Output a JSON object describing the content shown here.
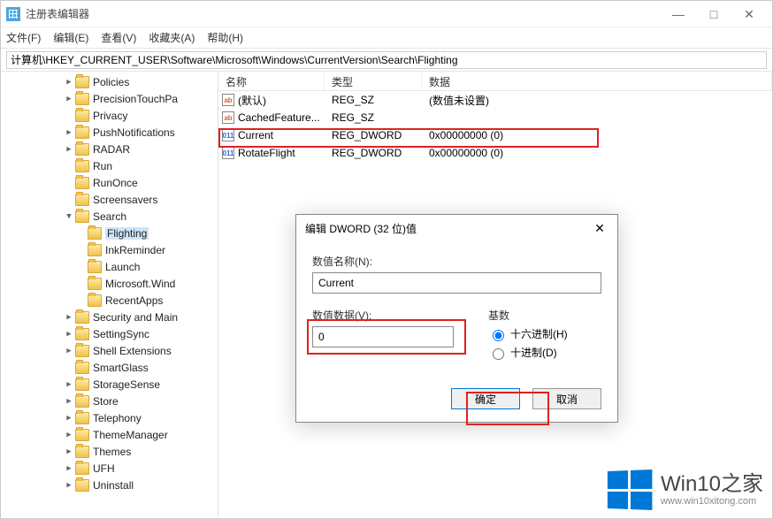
{
  "window": {
    "title": "注册表编辑器",
    "minimize": "—",
    "maximize": "□",
    "close": "✕"
  },
  "menu": {
    "file": "文件(F)",
    "edit": "编辑(E)",
    "view": "查看(V)",
    "favorites": "收藏夹(A)",
    "help": "帮助(H)"
  },
  "address": "计算机\\HKEY_CURRENT_USER\\Software\\Microsoft\\Windows\\CurrentVersion\\Search\\Flighting",
  "tree": [
    {
      "indent": 5,
      "exp": ">",
      "label": "Policies"
    },
    {
      "indent": 5,
      "exp": ">",
      "label": "PrecisionTouchPa"
    },
    {
      "indent": 5,
      "exp": "",
      "label": "Privacy"
    },
    {
      "indent": 5,
      "exp": ">",
      "label": "PushNotifications"
    },
    {
      "indent": 5,
      "exp": ">",
      "label": "RADAR"
    },
    {
      "indent": 5,
      "exp": "",
      "label": "Run"
    },
    {
      "indent": 5,
      "exp": "",
      "label": "RunOnce"
    },
    {
      "indent": 5,
      "exp": "",
      "label": "Screensavers"
    },
    {
      "indent": 5,
      "exp": "v",
      "label": "Search"
    },
    {
      "indent": 6,
      "exp": "",
      "label": "Flighting",
      "selected": true
    },
    {
      "indent": 6,
      "exp": "",
      "label": "InkReminder"
    },
    {
      "indent": 6,
      "exp": "",
      "label": "Launch"
    },
    {
      "indent": 6,
      "exp": "",
      "label": "Microsoft.Wind"
    },
    {
      "indent": 6,
      "exp": "",
      "label": "RecentApps"
    },
    {
      "indent": 5,
      "exp": ">",
      "label": "Security and Main"
    },
    {
      "indent": 5,
      "exp": ">",
      "label": "SettingSync"
    },
    {
      "indent": 5,
      "exp": ">",
      "label": "Shell Extensions"
    },
    {
      "indent": 5,
      "exp": "",
      "label": "SmartGlass"
    },
    {
      "indent": 5,
      "exp": ">",
      "label": "StorageSense"
    },
    {
      "indent": 5,
      "exp": ">",
      "label": "Store"
    },
    {
      "indent": 5,
      "exp": ">",
      "label": "Telephony"
    },
    {
      "indent": 5,
      "exp": ">",
      "label": "ThemeManager"
    },
    {
      "indent": 5,
      "exp": ">",
      "label": "Themes"
    },
    {
      "indent": 5,
      "exp": ">",
      "label": "UFH"
    },
    {
      "indent": 5,
      "exp": ">",
      "label": "Uninstall"
    }
  ],
  "list": {
    "headers": {
      "name": "名称",
      "type": "类型",
      "data": "数据"
    },
    "rows": [
      {
        "icon": "str",
        "name": "(默认)",
        "type": "REG_SZ",
        "data": "(数值未设置)"
      },
      {
        "icon": "str",
        "name": "CachedFeature...",
        "type": "REG_SZ",
        "data": ""
      },
      {
        "icon": "bin",
        "name": "Current",
        "type": "REG_DWORD",
        "data": "0x00000000 (0)",
        "highlight": true
      },
      {
        "icon": "bin",
        "name": "RotateFlight",
        "type": "REG_DWORD",
        "data": "0x00000000 (0)"
      }
    ]
  },
  "dialog": {
    "title": "编辑 DWORD (32 位)值",
    "name_label": "数值名称(N):",
    "name_value": "Current",
    "data_label": "数值数据(V):",
    "data_value": "0",
    "base_label": "基数",
    "radix_hex": "十六进制(H)",
    "radix_dec": "十进制(D)",
    "ok": "确定",
    "cancel": "取消"
  },
  "watermark": {
    "big": "Win10之家",
    "small": "www.win10xitong.com"
  }
}
